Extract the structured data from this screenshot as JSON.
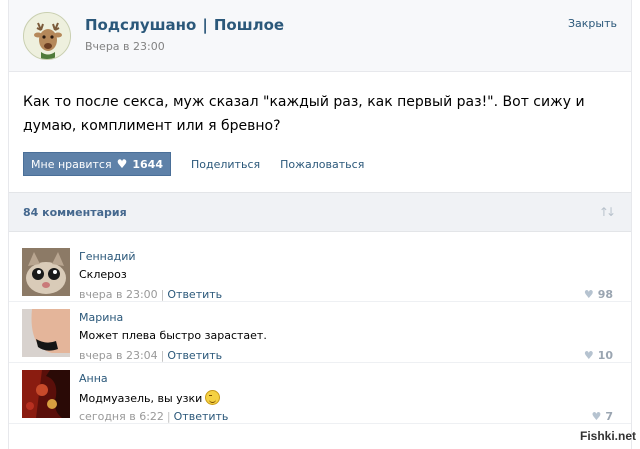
{
  "header": {
    "group_name": "Подслушано",
    "separator": "|",
    "subtitle": "Пошлое",
    "time": "Вчера в 23:00",
    "close_label": "Закрыть"
  },
  "post": {
    "text": "Как то после секса, муж сказал \"каждый раз, как первый раз!\". Вот сижу и думаю, комплимент или я бревно?",
    "like_label": "Мне нравится",
    "like_count": "1644",
    "share_label": "Поделиться",
    "report_label": "Пожаловаться"
  },
  "comments_header": {
    "count_label": "84 комментария",
    "sort_icon": "sort-arrows-icon"
  },
  "comments": [
    {
      "author": "Геннадий",
      "text": "Склероз",
      "time": "вчера в 23:00",
      "reply_label": "Ответить",
      "likes": "98",
      "avatar": "cat-photo"
    },
    {
      "author": "Марина",
      "text": "Может плева быстро зарастает.",
      "time": "вчера в 23:04",
      "reply_label": "Ответить",
      "likes": "10",
      "avatar": "body-photo"
    },
    {
      "author": "Анна",
      "text": "Модмуазель, вы узки",
      "time": "сегодня в 6:22",
      "reply_label": "Ответить",
      "likes": "7",
      "avatar": "red-photo",
      "emoji": "smile-icon"
    }
  ],
  "watermark": "Fishki.net",
  "colors": {
    "link": "#2b587a",
    "like_button": "#5e81a8",
    "header_bg": "#f7f8fa",
    "comments_bar_bg": "#f0f2f5"
  }
}
